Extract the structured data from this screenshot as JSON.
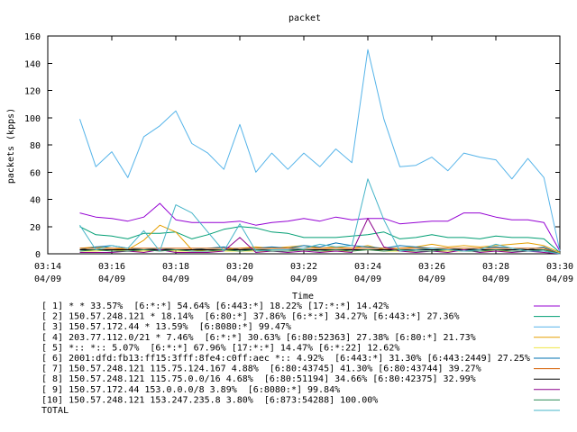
{
  "chart_data": {
    "type": "line",
    "title": "packet",
    "xlabel": "Time",
    "ylabel": "packets (kpps)",
    "ylim": [
      0,
      160
    ],
    "xlim": [
      0,
      16
    ],
    "yticks": [
      0,
      20,
      40,
      60,
      80,
      100,
      120,
      140,
      160
    ],
    "xticks": [
      {
        "x": 0,
        "time": "03:14",
        "date": "04/09"
      },
      {
        "x": 2,
        "time": "03:16",
        "date": "04/09"
      },
      {
        "x": 4,
        "time": "03:18",
        "date": "04/09"
      },
      {
        "x": 6,
        "time": "03:20",
        "date": "04/09"
      },
      {
        "x": 8,
        "time": "03:22",
        "date": "04/09"
      },
      {
        "x": 10,
        "time": "03:24",
        "date": "04/09"
      },
      {
        "x": 12,
        "time": "03:26",
        "date": "04/09"
      },
      {
        "x": 14,
        "time": "03:28",
        "date": "04/09"
      },
      {
        "x": 16,
        "time": "03:30",
        "date": "04/09"
      }
    ],
    "x": [
      1.0,
      1.5,
      2.0,
      2.5,
      3.0,
      3.5,
      4.0,
      4.5,
      5.0,
      5.5,
      6.0,
      6.5,
      7.0,
      7.5,
      8.0,
      8.5,
      9.0,
      9.5,
      10.0,
      10.5,
      11.0,
      11.5,
      12.0,
      12.5,
      13.0,
      13.5,
      14.0,
      14.5,
      15.0,
      15.5,
      16.0
    ],
    "grid": false,
    "legend_position": "bottom",
    "series": [
      {
        "name": "[ 1] * * 33.57%  [6:*:*] 54.64% [6:443:*] 18.22% [17:*:*] 14.42%",
        "color": "#9400d3",
        "values": [
          30,
          27,
          26,
          24,
          27,
          37,
          25,
          23,
          23,
          23,
          24,
          21,
          23,
          24,
          26,
          24,
          27,
          25,
          26,
          26,
          22,
          23,
          24,
          24,
          30,
          30,
          27,
          25,
          25,
          23,
          2
        ]
      },
      {
        "name": "[ 2] 150.57.248.121 * 18.14%  [6:80:*] 37.86% [6:*:*] 34.27% [6:443:*] 27.36%",
        "color": "#009e73",
        "values": [
          20,
          14,
          13,
          11,
          15,
          15,
          16,
          11,
          14,
          18,
          20,
          19,
          16,
          15,
          12,
          12,
          12,
          13,
          14,
          16,
          11,
          12,
          14,
          12,
          12,
          11,
          13,
          12,
          12,
          11,
          1
        ]
      },
      {
        "name": "[ 3] 150.57.172.44 * 13.59%  [6:8080:*] 99.47%",
        "color": "#56b4e9",
        "values": [
          99,
          64,
          75,
          56,
          86,
          94,
          105,
          81,
          74,
          62,
          95,
          60,
          74,
          62,
          74,
          64,
          77,
          67,
          150,
          99,
          64,
          65,
          71,
          61,
          74,
          71,
          69,
          55,
          70,
          56,
          2
        ]
      },
      {
        "name": "[ 4] 203.77.112.0/21 * 7.46%  [6:*:*] 30.63% [6:80:52363] 27.38% [6:80:*] 21.73%",
        "color": "#e69f00",
        "values": [
          4,
          5,
          4,
          3,
          10,
          21,
          16,
          3,
          2,
          3,
          4,
          5,
          4,
          5,
          6,
          4,
          5,
          4,
          6,
          3,
          4,
          5,
          7,
          5,
          6,
          5,
          6,
          7,
          8,
          6,
          1
        ]
      },
      {
        "name": "[ 5] *:: *:: 5.07%  [6:*:*] 67.96% [17:*:*] 14.47% [6:*:22] 12.62%",
        "color": "#f0e442",
        "values": [
          2,
          2,
          3,
          2,
          2,
          3,
          2,
          2,
          2,
          2,
          2,
          2,
          2,
          2,
          3,
          2,
          2,
          2,
          3,
          2,
          2,
          2,
          2,
          2,
          2,
          2,
          2,
          2,
          2,
          2,
          0
        ]
      },
      {
        "name": "[ 6] 2001:dfd:fb13:ff15:3fff:8fe4:c0ff:aec *:: 4.92%  [6:443:*] 31.30% [6:443:2449] 27.25%",
        "color": "#0072b2",
        "values": [
          3,
          5,
          6,
          4,
          3,
          4,
          3,
          3,
          4,
          5,
          3,
          4,
          5,
          4,
          6,
          5,
          8,
          6,
          5,
          4,
          6,
          5,
          4,
          4,
          3,
          4,
          5,
          4,
          3,
          5,
          0
        ]
      },
      {
        "name": "[ 7] 150.57.248.121 115.75.124.167 4.88%  [6:80:43745] 41.30% [6:80:43744] 39.27%",
        "color": "#d55e00",
        "values": [
          4,
          4,
          4,
          4,
          4,
          4,
          4,
          4,
          4,
          4,
          4,
          4,
          4,
          4,
          4,
          4,
          4,
          4,
          4,
          4,
          4,
          4,
          4,
          4,
          4,
          4,
          4,
          4,
          4,
          4,
          0
        ]
      },
      {
        "name": "[ 8] 150.57.248.121 115.75.0.0/16 4.68%  [6:80:51194] 34.66% [6:80:42375] 32.99%",
        "color": "#000000",
        "values": [
          3,
          3,
          3,
          3,
          3,
          3,
          3,
          3,
          3,
          3,
          3,
          3,
          3,
          3,
          3,
          3,
          3,
          3,
          3,
          3,
          3,
          3,
          3,
          3,
          3,
          3,
          3,
          3,
          3,
          3,
          0
        ]
      },
      {
        "name": "[ 9] 150.57.172.44 153.0.0.0/8 3.89%  [6:8080:*] 99.84%",
        "color": "#8b008b",
        "values": [
          1,
          1,
          1,
          2,
          1,
          3,
          1,
          1,
          1,
          2,
          12,
          1,
          2,
          1,
          2,
          1,
          2,
          1,
          26,
          5,
          2,
          1,
          2,
          1,
          3,
          1,
          2,
          1,
          2,
          1,
          0
        ]
      },
      {
        "name": "[10] 150.57.248.121 153.247.235.8 3.80%  [6:873:54288] 100.00%",
        "color": "#2e8b57",
        "values": [
          2,
          3,
          2,
          2,
          3,
          2,
          3,
          2,
          2,
          3,
          2,
          3,
          2,
          2,
          3,
          2,
          3,
          2,
          3,
          2,
          3,
          2,
          2,
          3,
          2,
          2,
          3,
          2,
          2,
          3,
          0
        ]
      },
      {
        "name": "TOTAL",
        "color": "#46b4c8",
        "values": [
          21,
          3,
          6,
          4,
          17,
          2,
          36,
          30,
          16,
          2,
          22,
          2,
          3,
          3,
          4,
          7,
          5,
          6,
          55,
          25,
          2,
          3,
          4,
          3,
          2,
          3,
          7,
          4,
          2,
          2,
          0
        ]
      }
    ]
  }
}
